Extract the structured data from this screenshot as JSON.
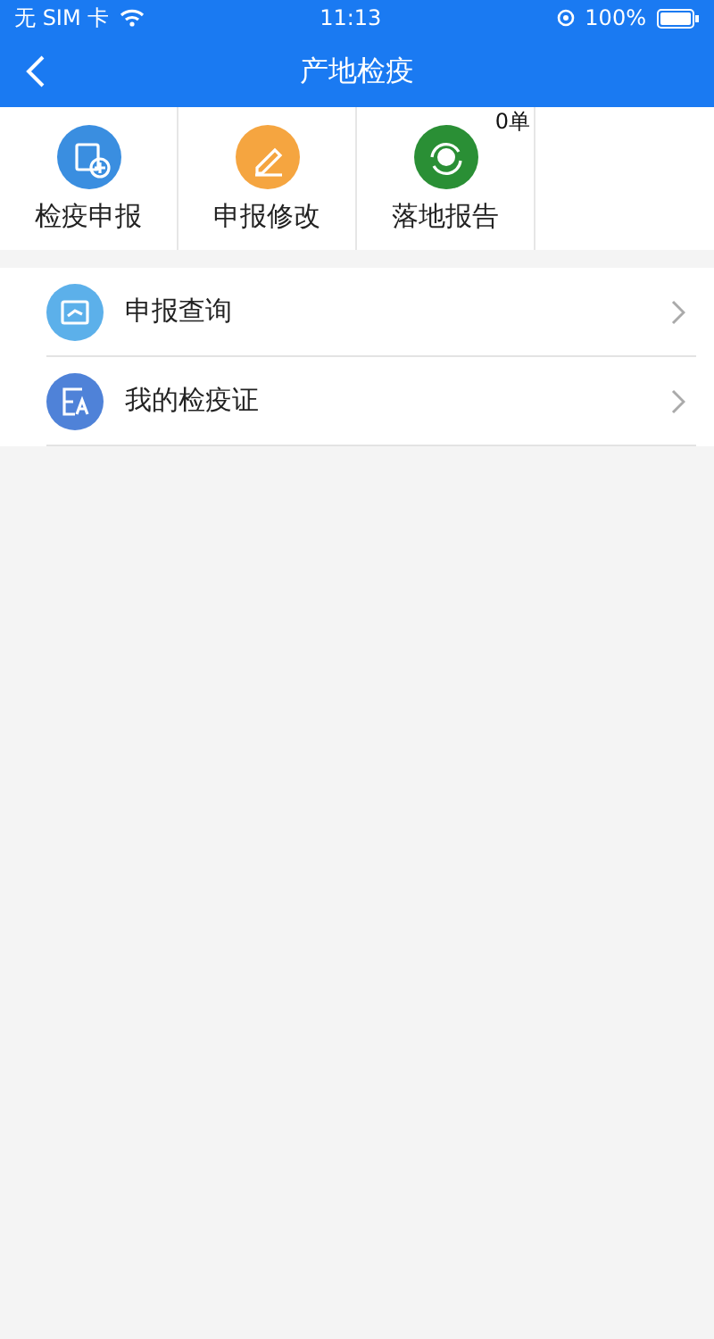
{
  "status_bar": {
    "carrier": "无 SIM 卡",
    "time": "11:13",
    "battery": "100%"
  },
  "nav": {
    "title": "产地检疫"
  },
  "tiles": [
    {
      "label": "检疫申报",
      "kind": "add",
      "color": "#3a8ee0"
    },
    {
      "label": "申报修改",
      "kind": "edit",
      "color": "#f5a540"
    },
    {
      "label": "落地报告",
      "kind": "landing",
      "color": "#2a8f35",
      "badge": "0单"
    }
  ],
  "menu": [
    {
      "label": "申报查询",
      "kind": "query",
      "color": "#5cb0ea"
    },
    {
      "label": "我的检疫证",
      "kind": "certificate",
      "color": "#4f82d8"
    }
  ]
}
